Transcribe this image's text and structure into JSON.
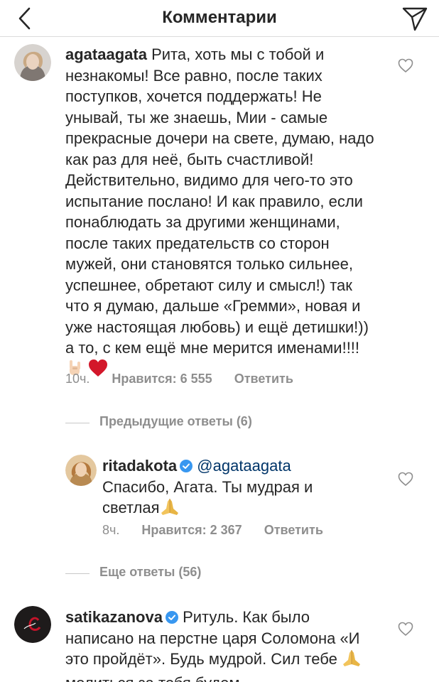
{
  "header": {
    "title": "Комментарии"
  },
  "comments": [
    {
      "username": "agataagata",
      "text": "Рита, хоть мы с тобой и незнакомы! Все равно, после таких поступков, хочется поддержать! Не унывай, ты же знаешь, Мии - самые прекрасные дочери на свете, думаю, надо как раз для неё, быть счастливой! Действительно, видимо для чего-то это испытание послано! И как правило, если понаблюдать за другими женщинами, после таких предательств со сторон мужей, они становятся только сильнее, успешнее, обретают силу и смысл!) так что я думаю, дальше «Гремми», новая и уже настоящая любовь) и ещё детишки!)) а то, с кем ещё мне мерится именами!!!!",
      "time": "10ч.",
      "likes": "Нравится: 6 555",
      "reply": "Ответить"
    },
    {
      "username": "ritadakota",
      "mention": "@agataagata",
      "text": "Спасибо, Агата. Ты мудрая и светлая",
      "time": "8ч.",
      "likes": "Нравится: 2 367",
      "reply": "Ответить"
    },
    {
      "username": "satikazanova",
      "text": "Ритуль. Как было написано на перстне царя Соломона «И это пройдёт». Будь мудрой. Сил тебе",
      "text_end": "молиться за тебя будем."
    }
  ],
  "replies": {
    "previous": "Предыдущие ответы (6)",
    "more": "Еще ответы (56)"
  },
  "icons": [
    "back-arrow-icon",
    "send-icon",
    "heart-icon",
    "verified-icon",
    "rock-hand-emoji",
    "red-heart-emoji",
    "folded-hands-emoji"
  ],
  "colors": {
    "text": "#262626",
    "muted": "#8e8e8e",
    "mention": "#003569",
    "verified": "#3897f0"
  }
}
